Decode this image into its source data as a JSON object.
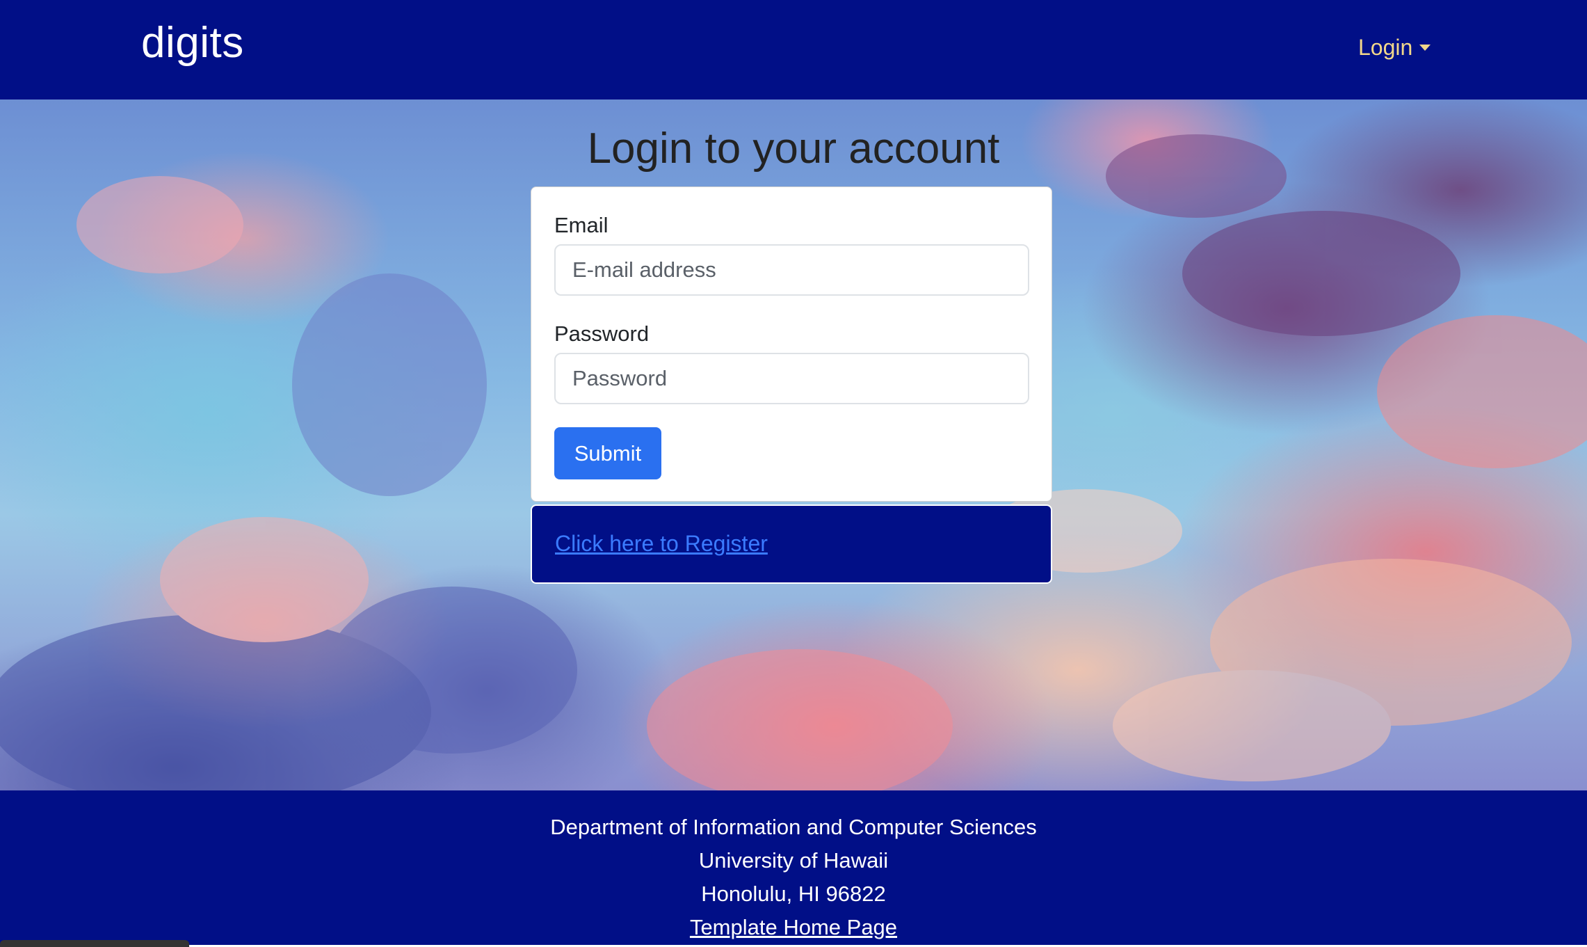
{
  "navbar": {
    "brand": "digits",
    "login_label": "Login"
  },
  "hero": {
    "title": "Login to your account"
  },
  "form": {
    "email_label": "Email",
    "email_placeholder": "E-mail address",
    "password_label": "Password",
    "password_placeholder": "Password",
    "submit_label": "Submit"
  },
  "register": {
    "link_text": "Click here to Register"
  },
  "footer": {
    "line1": "Department of Information and Computer Sciences",
    "line2": "University of Hawaii",
    "line3": "Honolulu, HI 96822",
    "link_text": "Template Home Page"
  },
  "colors": {
    "navbar_bg": "#010f87",
    "nav_login": "#f2d78a",
    "submit_bg": "#2a70f0",
    "register_link": "#3b7bff"
  },
  "icons": {
    "nav_dropdown": "caret-down-icon"
  }
}
